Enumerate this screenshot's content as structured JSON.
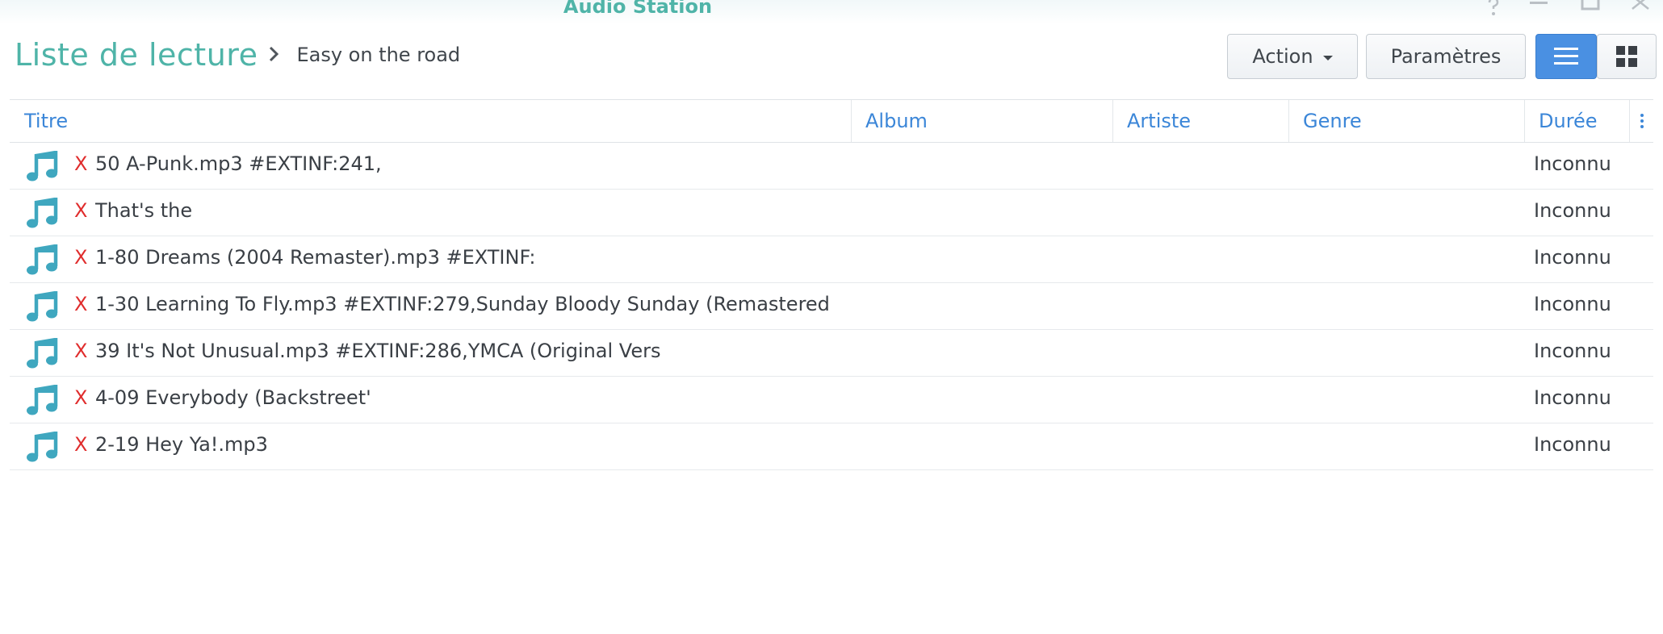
{
  "window": {
    "title": "Audio Station",
    "controls": [
      "help-icon",
      "minimize-icon",
      "maximize-icon",
      "close-icon"
    ]
  },
  "breadcrumb": {
    "root": "Liste de lecture",
    "current": "Easy on the road"
  },
  "toolbar": {
    "action_label": "Action",
    "settings_label": "Paramètres",
    "list_view_icon": "list-view-icon",
    "grid_view_icon": "grid-view-icon"
  },
  "table": {
    "columns": [
      "Titre",
      "Album",
      "Artiste",
      "Genre",
      "Durée"
    ],
    "rows": [
      {
        "marker": "X",
        "title": "50 A-Punk.mp3 #EXTINF:241,",
        "album": "",
        "artist": "",
        "genre": "",
        "duration": "Inconnu"
      },
      {
        "marker": "X",
        "title": "That's the",
        "album": "",
        "artist": "",
        "genre": "",
        "duration": "Inconnu"
      },
      {
        "marker": "X",
        "title": "1-80 Dreams (2004 Remaster).mp3 #EXTINF:",
        "album": "",
        "artist": "",
        "genre": "",
        "duration": "Inconnu"
      },
      {
        "marker": "X",
        "title": "1-30 Learning To Fly.mp3 #EXTINF:279,Sunday Bloody Sunday (Remastered",
        "album": "",
        "artist": "",
        "genre": "",
        "duration": "Inconnu"
      },
      {
        "marker": "X",
        "title": "39 It's Not Unusual.mp3 #EXTINF:286,YMCA (Original Vers",
        "album": "",
        "artist": "",
        "genre": "",
        "duration": "Inconnu"
      },
      {
        "marker": "X",
        "title": "4-09 Everybody (Backstreet'",
        "album": "",
        "artist": "",
        "genre": "",
        "duration": "Inconnu"
      },
      {
        "marker": "X",
        "title": "2-19 Hey Ya!.mp3",
        "album": "",
        "artist": "",
        "genre": "",
        "duration": "Inconnu"
      }
    ]
  },
  "colors": {
    "accent_teal": "#4fb4a8",
    "header_blue": "#3b86d8",
    "active_view": "#4a90e2",
    "error_mark": "#e02d2d"
  }
}
